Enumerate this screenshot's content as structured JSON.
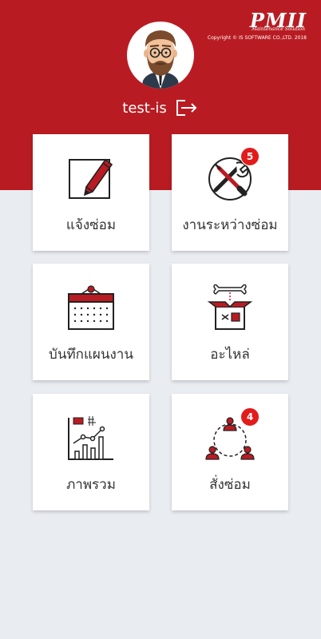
{
  "brand": {
    "logo_text": "PMII",
    "tagline": "Maintenance Solution",
    "copyright": "Copyright © IS SOFTWARE CO.,LTD. 2018"
  },
  "user": {
    "name": "test-is",
    "avatar_icon": "bearded-man-avatar",
    "logout_icon": "logout-icon"
  },
  "colors": {
    "header_bg": "#b81c22",
    "page_bg": "#e9ecf1",
    "badge": "#e21b1b",
    "icon_accent": "#b81c22"
  },
  "menu": [
    {
      "label": "แจ้งซ่อม",
      "icon": "pencil-icon"
    },
    {
      "label": "งานระหว่างซ่อม",
      "icon": "wrench-screwdriver-icon",
      "badge": "5"
    },
    {
      "label": "บันทึกแผนงาน",
      "icon": "calendar-icon"
    },
    {
      "label": "อะไหล่",
      "icon": "spare-parts-box-icon"
    },
    {
      "label": "ภาพรวม",
      "icon": "chart-icon"
    },
    {
      "label": "สั่งซ่อม",
      "icon": "team-cycle-icon",
      "badge": "4"
    }
  ]
}
